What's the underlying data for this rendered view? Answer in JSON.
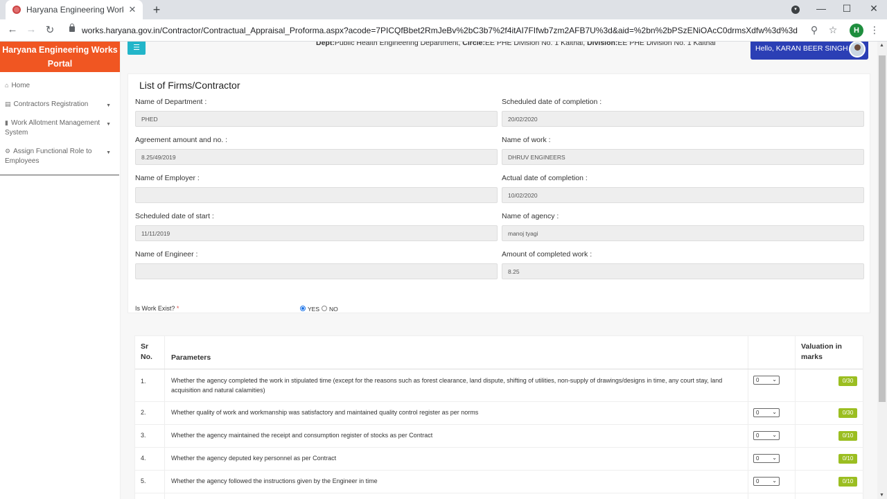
{
  "browser": {
    "tab_title": "Haryana Engineering Works Portal",
    "new_tab": "+",
    "tab_close": "✕",
    "url": "works.haryana.gov.in/Contractor/Contractual_Appraisal_Proforma.aspx?acode=7PICQfBbet2RmJeBv%2bC3b7%2f4itAI7FIfwb7zm2AFB7U%3d&aid=%2bn%2bPSzENiOAcC0drmsXdfw%3d%3d",
    "profile_initial": "H",
    "icons": [
      "back-icon",
      "forward-icon",
      "reload-icon",
      "lock-icon",
      "zoom-icon",
      "star-icon",
      "menu-icon"
    ]
  },
  "sidebar": {
    "brand": "Haryana Engineering Works Portal",
    "items": [
      {
        "label": "Home",
        "icon": "home-icon",
        "has_caret": false
      },
      {
        "label": "Contractors Registration",
        "icon": "list-icon",
        "has_caret": true
      },
      {
        "label": "Work Allotment Management System",
        "icon": "book-icon",
        "has_caret": true
      },
      {
        "label": "Assign Functional Role to Employees",
        "icon": "gear-icon",
        "has_caret": true
      }
    ]
  },
  "header": {
    "dept_label": "Dept:",
    "dept_value": "Public Health Engineering Department,",
    "circle_label": "Circle:",
    "circle_value": "EE PHE Division No. 1 Kaithal,",
    "division_label": "Division:",
    "division_value": "EE PHE Division No. 1 Kaithal",
    "greeting": "Hello, KARAN BEER SINGH"
  },
  "form": {
    "title": "List of Firms/Contractor",
    "fields": [
      {
        "label": "Name of Department :",
        "value": "PHED"
      },
      {
        "label": "Scheduled date of completion :",
        "value": "20/02/2020"
      },
      {
        "label": "Agreement amount and no. :",
        "value": "8.25/49/2019"
      },
      {
        "label": "Name of work :",
        "value": "DHRUV ENGINEERS"
      },
      {
        "label": "Name of Employer :",
        "value": ""
      },
      {
        "label": "Actual date of completion :",
        "value": "10/02/2020"
      },
      {
        "label": "Scheduled date of start :",
        "value": "11/11/2019"
      },
      {
        "label": "Name of agency :",
        "value": "manoj tyagi"
      },
      {
        "label": "Name of Engineer :",
        "value": ""
      },
      {
        "label": "Amount of completed work :",
        "value": "8.25"
      }
    ],
    "work_exist_label": "Is Work Exist?",
    "required_mark": "*",
    "radio_yes": "YES",
    "radio_no": "NO",
    "selected": "YES"
  },
  "table": {
    "headers": {
      "sr": "Sr No.",
      "parameters": "Parameters",
      "valuation": "Valuation in marks"
    },
    "rows": [
      {
        "no": "1.",
        "param": "Whether the agency completed the work in stipulated time (except for the reasons such as forest clearance, land dispute, shifting of utilities, non-supply of drawings/designs in time, any court stay, land acquisition and natural calamities)",
        "select": "0",
        "mark": "0/30"
      },
      {
        "no": "2.",
        "param": "Whether quality of work and workmanship was satisfactory and maintained quality control register as per norms",
        "select": "0",
        "mark": "0/30"
      },
      {
        "no": "3.",
        "param": "Whether the agency maintained the receipt and consumption register of stocks as per Contract",
        "select": "0",
        "mark": "0/10"
      },
      {
        "no": "4.",
        "param": "Whether the agency deputed key personnel as per Contract",
        "select": "0",
        "mark": "0/10"
      },
      {
        "no": "5.",
        "param": "Whether the agency followed the instructions given by the Engineer in time",
        "select": "0",
        "mark": "0/10"
      }
    ]
  },
  "colors": {
    "brand": "#f05622",
    "toggle": "#22b5c9",
    "hello": "#2b3fb5",
    "mark": "#9bbe21"
  }
}
